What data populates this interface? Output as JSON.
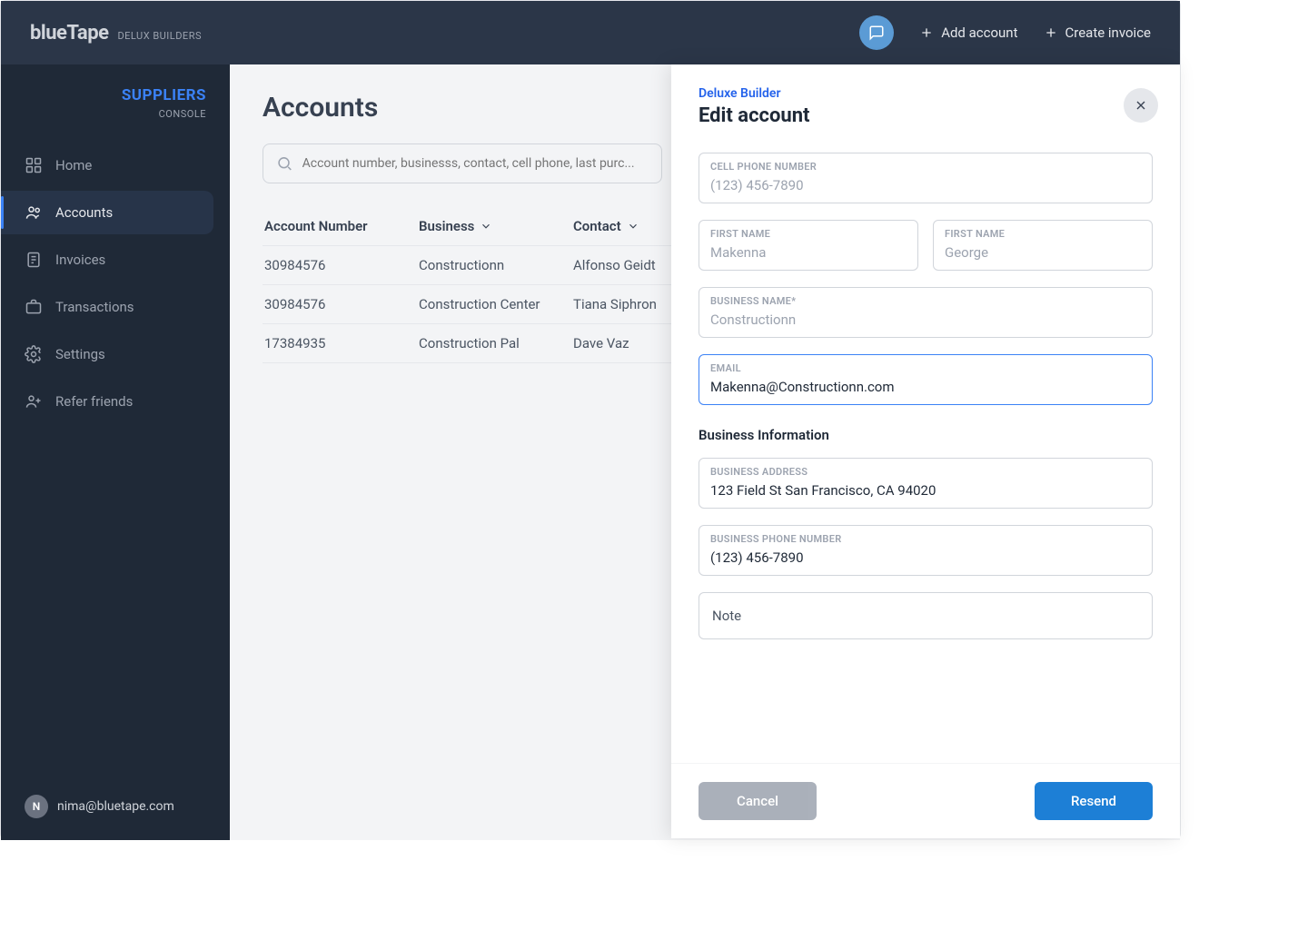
{
  "header": {
    "brand": "blueTape",
    "brand_sub": "DELUX BUILDERS",
    "add_account": "Add account",
    "create_invoice": "Create invoice"
  },
  "sidebar": {
    "title": "SUPPLIERS",
    "subtitle": "CONSOLE",
    "items": [
      {
        "label": "Home"
      },
      {
        "label": "Accounts"
      },
      {
        "label": "Invoices"
      },
      {
        "label": "Transactions"
      },
      {
        "label": "Settings"
      },
      {
        "label": "Refer friends"
      }
    ],
    "user_initial": "N",
    "user_email": "nima@bluetape.com"
  },
  "main": {
    "title": "Accounts",
    "search_placeholder": "Account number, businesss, contact, cell phone, last purc...",
    "columns": {
      "acct": "Account Number",
      "business": "Business",
      "contact": "Contact"
    },
    "rows": [
      {
        "acct": "30984576",
        "business": "Constructionn",
        "contact": "Alfonso Geidt"
      },
      {
        "acct": "30984576",
        "business": "Construction Center",
        "contact": "Tiana Siphron"
      },
      {
        "acct": "17384935",
        "business": "Construction Pal",
        "contact": "Dave Vaz"
      }
    ]
  },
  "drawer": {
    "supertitle": "Deluxe Builder",
    "title": "Edit account",
    "labels": {
      "cell": "CELL PHONE NUMBER",
      "first1": "FIRST NAME",
      "first2": "FIRST NAME",
      "bizname": "BUSINESS NAME*",
      "email": "EMAIL",
      "section": "Business Information",
      "bizaddr": "BUSINESS ADDRESS",
      "bizphone": "BUSINESS PHONE NUMBER",
      "note": "Note"
    },
    "placeholders": {
      "cell": "(123) 456-7890",
      "first1": "Makenna",
      "first2": "George",
      "bizname": "Constructionn"
    },
    "values": {
      "email": "Makenna@Constructionn.com",
      "bizaddr": "123 Field St San Francisco, CA 94020",
      "bizphone": "(123) 456-7890"
    },
    "buttons": {
      "cancel": "Cancel",
      "resend": "Resend"
    }
  }
}
